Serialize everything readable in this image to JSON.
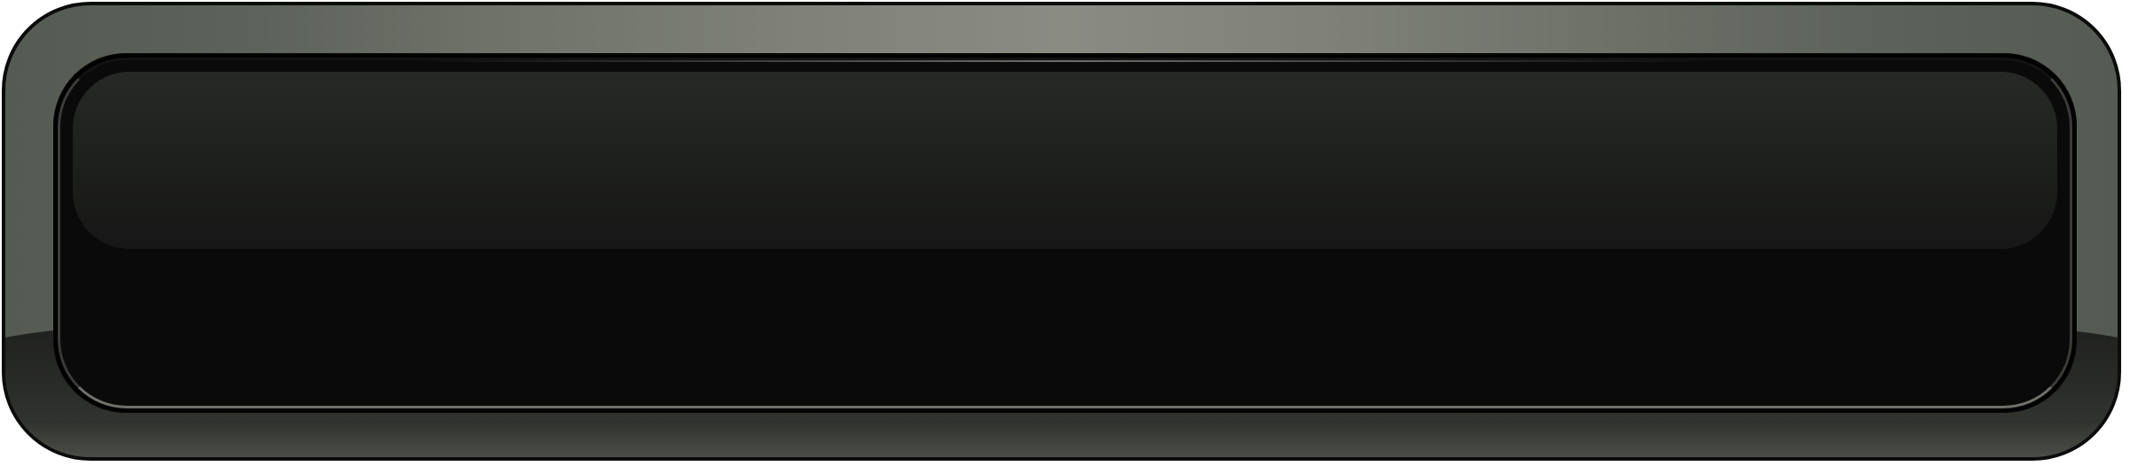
{
  "button": {
    "label": ""
  },
  "colors": {
    "shell_light": "#8a8c83",
    "shell_dark": "#555a53",
    "outline": "#0b0c0b",
    "face": "#0a0a0a",
    "gloss": "#272926",
    "inner_rim": "#6e706a"
  }
}
